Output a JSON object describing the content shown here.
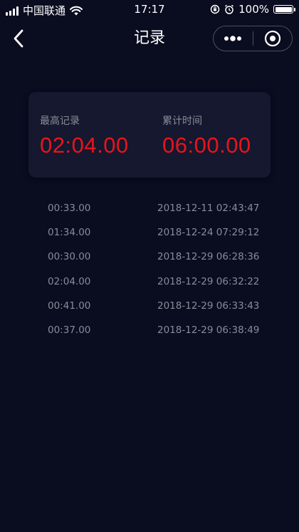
{
  "status_bar": {
    "carrier": "中国联通",
    "time": "17:17",
    "battery": "100%",
    "battery_level": 1.0
  },
  "nav": {
    "title": "记录",
    "back_icon": "chevron-left-icon",
    "more_icon": "more-dots-icon",
    "close_icon": "target-circle-icon"
  },
  "summary": {
    "best_label": "最高记录",
    "best_value": "02:04.00",
    "total_label": "累计时间",
    "total_value": "06:00.00",
    "value_color": "#e8141e"
  },
  "records": [
    {
      "duration": "00:33.00",
      "datetime": "2018-12-11 02:43:47"
    },
    {
      "duration": "01:34.00",
      "datetime": "2018-12-24 07:29:12"
    },
    {
      "duration": "00:30.00",
      "datetime": "2018-12-29 06:28:36"
    },
    {
      "duration": "02:04.00",
      "datetime": "2018-12-29 06:32:22"
    },
    {
      "duration": "00:41.00",
      "datetime": "2018-12-29 06:33:43"
    },
    {
      "duration": "00:37.00",
      "datetime": "2018-12-29 06:38:49"
    }
  ],
  "colors": {
    "background": "#0a0c1f",
    "card": "#15182e",
    "muted_text": "#8a8c99"
  }
}
